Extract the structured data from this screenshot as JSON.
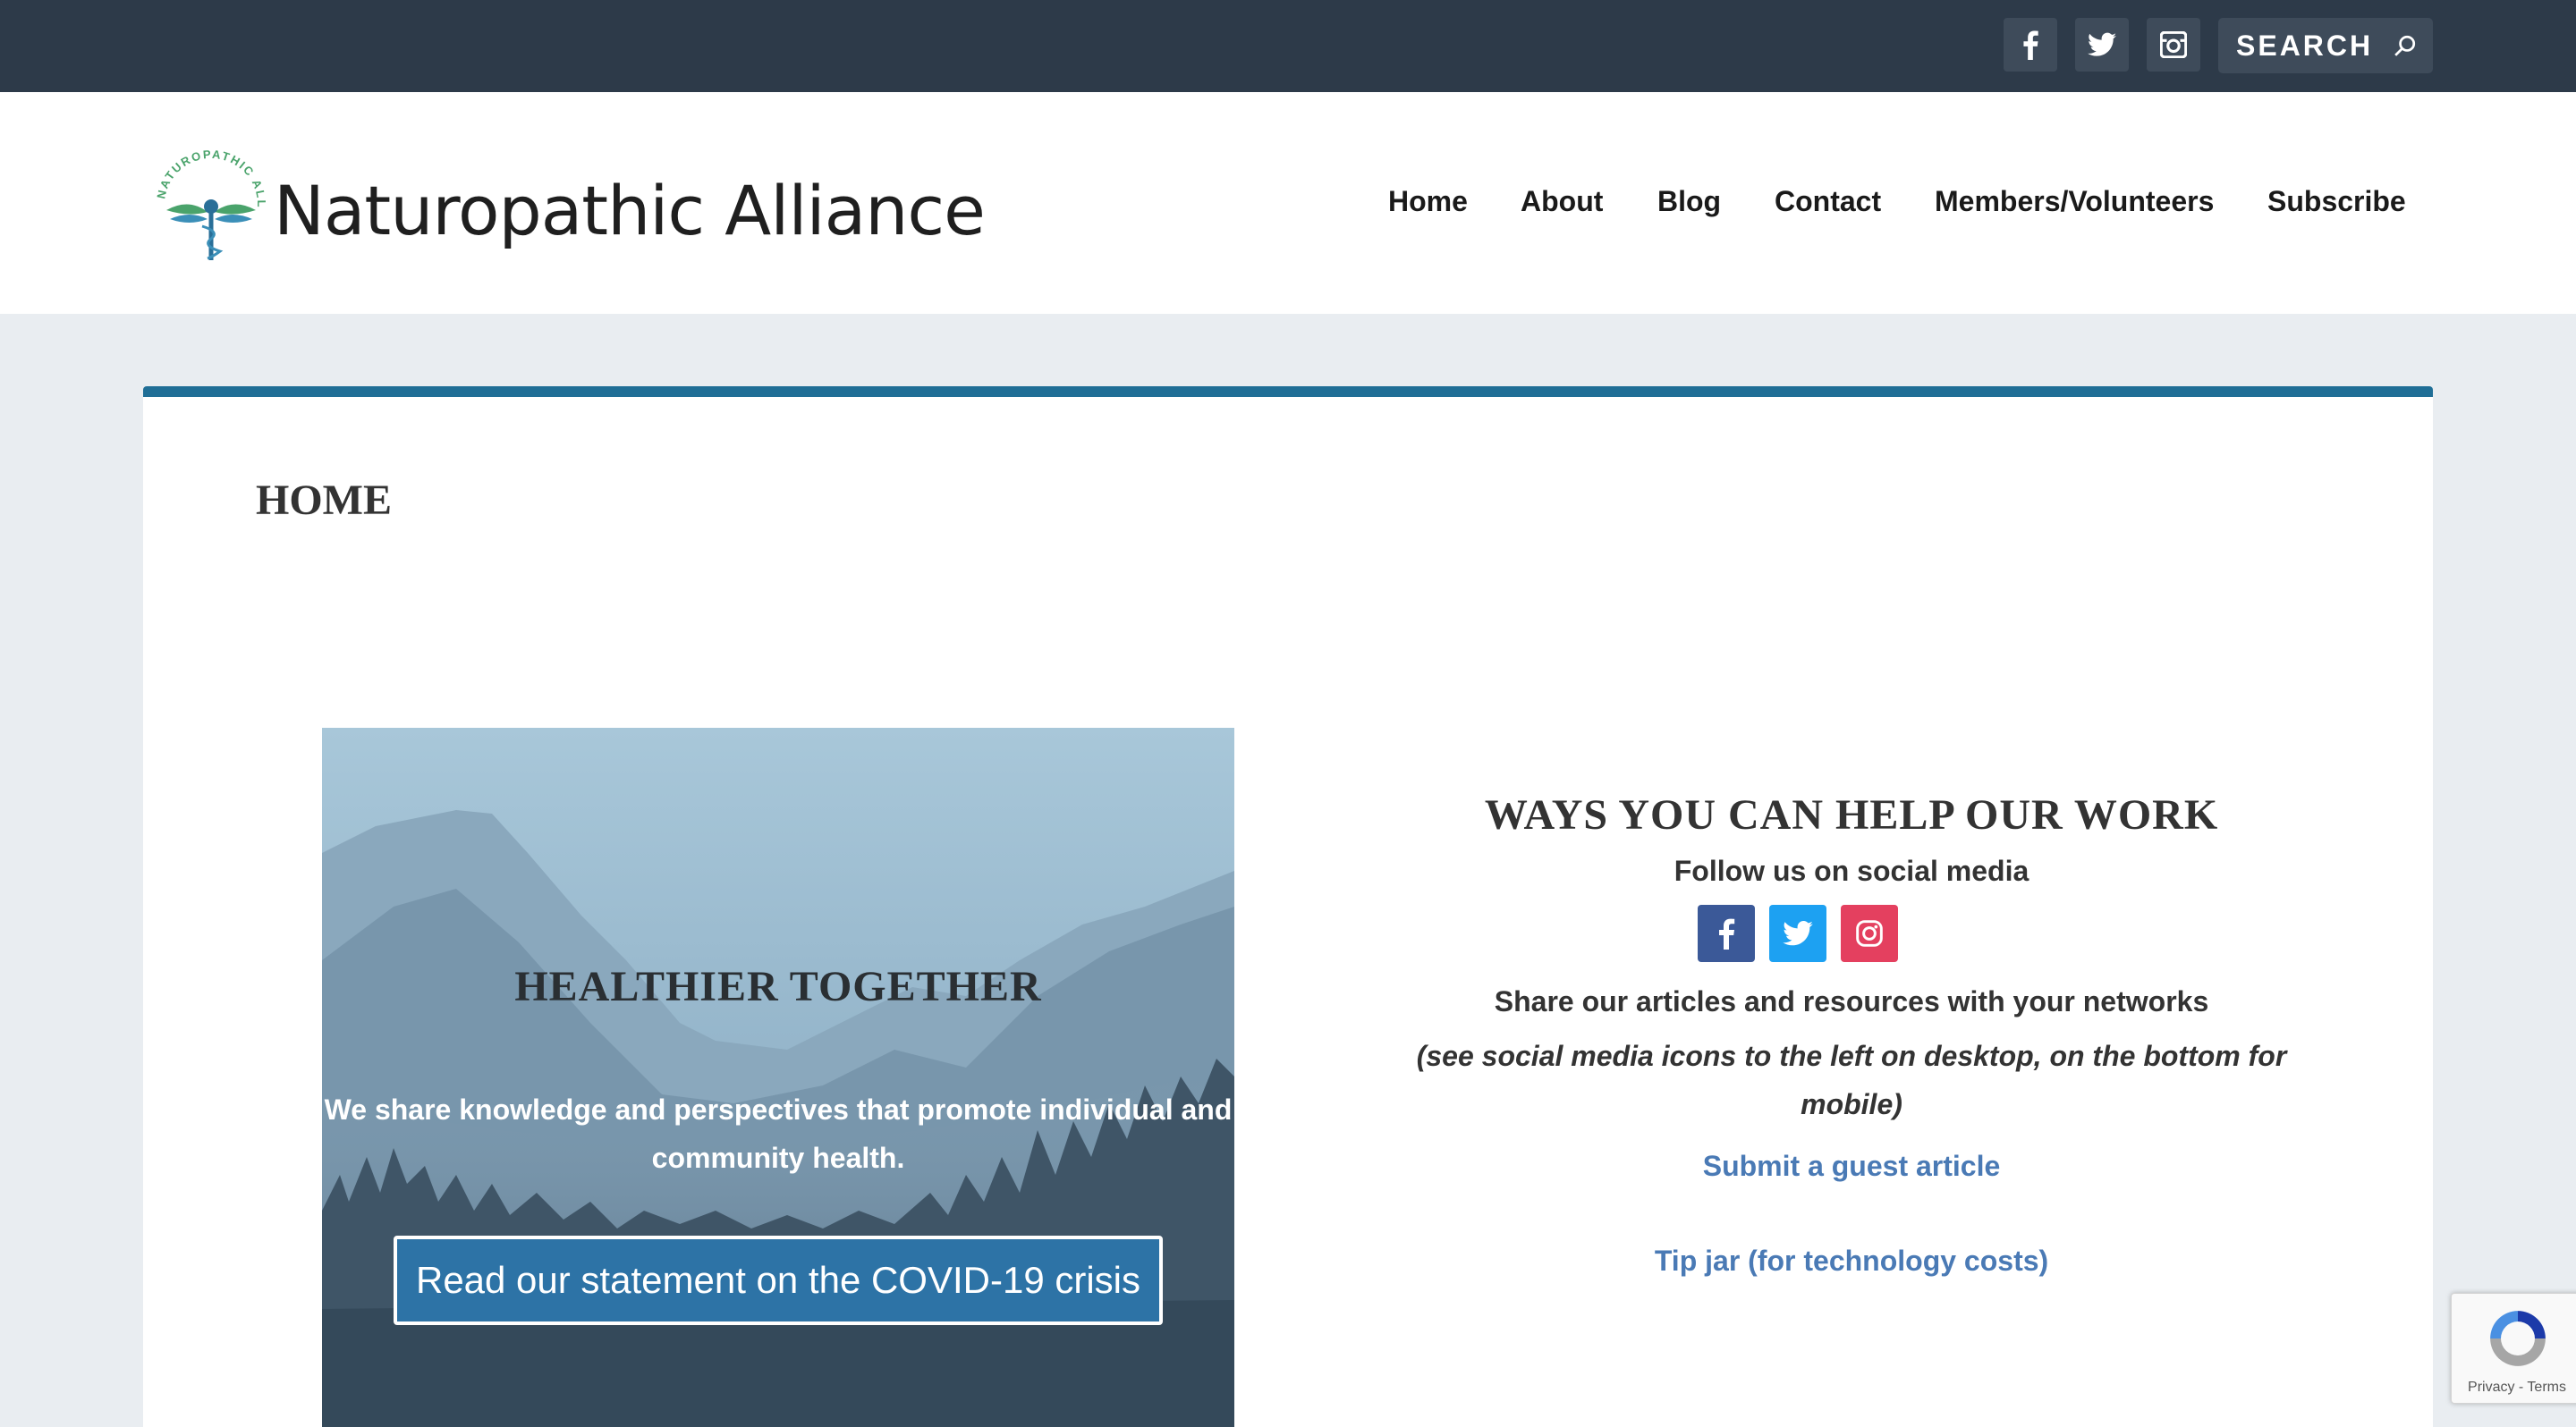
{
  "topbar": {
    "social": [
      "facebook-icon",
      "twitter-icon",
      "instagram-icon"
    ],
    "search_label": "SEARCH"
  },
  "header": {
    "logo_text": "Naturopathic Alliance",
    "logo_arc_text": "NATUROPATHIC ALLIANCE",
    "nav": [
      "Home",
      "About",
      "Blog",
      "Contact",
      "Members/Volunteers",
      "Subscribe"
    ]
  },
  "page": {
    "title": "HOME"
  },
  "hero": {
    "title": "HEALTHIER TOGETHER",
    "text_line1": "We share knowledge and perspectives that promote individual and",
    "text_line2": "community health.",
    "button_label": "Read our statement on the COVID-19 crisis"
  },
  "help": {
    "title": "WAYS YOU CAN HELP OUR WORK",
    "follow": "Follow us on social media",
    "share": "Share our articles and resources with your networks",
    "share_note_line1": "(see social media icons to the left on desktop, on the bottom for",
    "share_note_line2": "mobile)",
    "submit_link": "Submit a guest article",
    "tip_link": "Tip jar (for technology costs)"
  },
  "recaptcha": {
    "links": "Privacy - Terms"
  },
  "colors": {
    "topbar": "#2d3a49",
    "accent": "#1f6e96",
    "button": "#2d73a6",
    "link": "#4a7ab5",
    "facebook": "#3b5998",
    "twitter": "#1da1f2",
    "instagram": "#e4405f"
  }
}
